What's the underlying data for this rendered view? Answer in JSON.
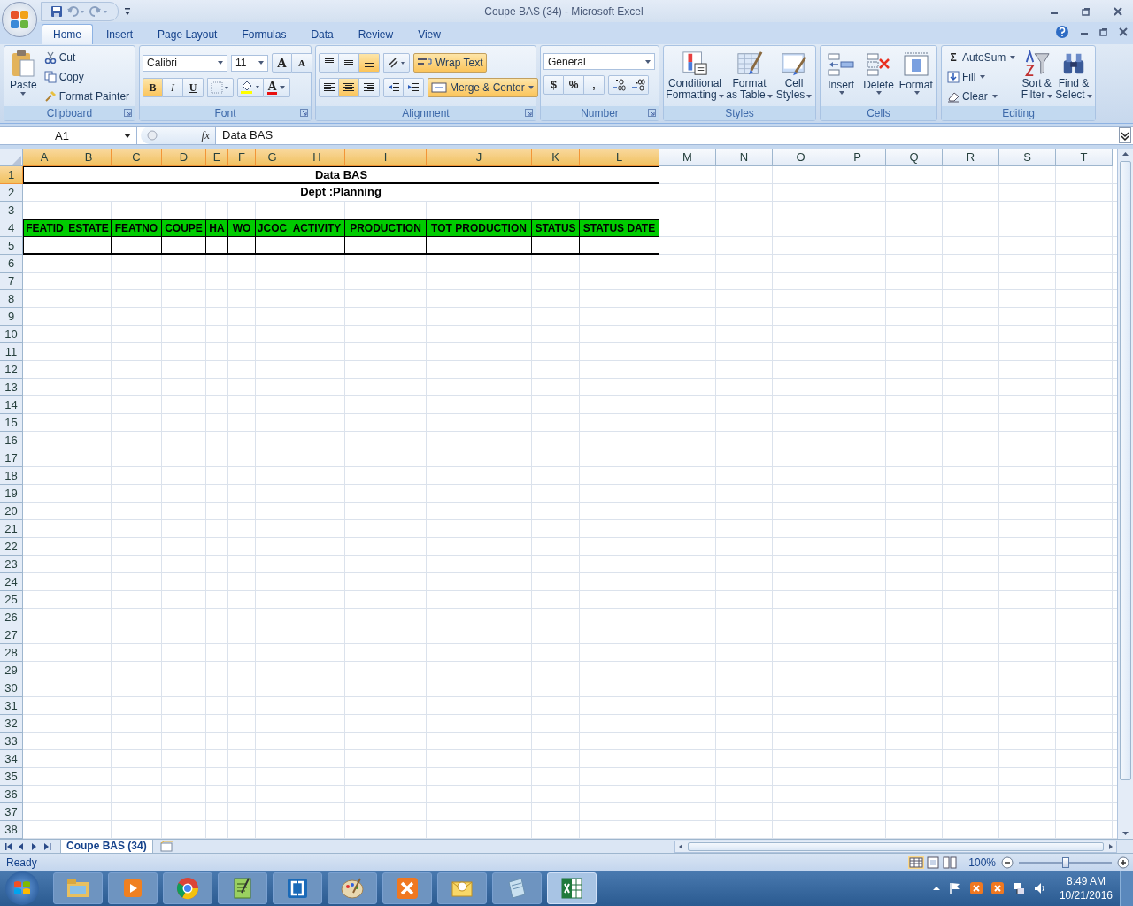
{
  "window": {
    "title": "Coupe BAS (34) - Microsoft Excel"
  },
  "tabs": [
    {
      "label": "Home",
      "selected": true
    },
    {
      "label": "Insert",
      "selected": false
    },
    {
      "label": "Page Layout",
      "selected": false
    },
    {
      "label": "Formulas",
      "selected": false
    },
    {
      "label": "Data",
      "selected": false
    },
    {
      "label": "Review",
      "selected": false
    },
    {
      "label": "View",
      "selected": false
    }
  ],
  "clipboard": {
    "label": "Clipboard",
    "paste": "Paste",
    "cut": "Cut",
    "copy": "Copy",
    "format_painter": "Format Painter"
  },
  "font": {
    "label": "Font",
    "family": "Calibri",
    "size": "11",
    "grow": "A",
    "shrink": "A",
    "styles": [
      {
        "label": "B",
        "on": true
      },
      {
        "label": "I",
        "on": false
      },
      {
        "label": "U",
        "on": false
      }
    ],
    "font_color": "A"
  },
  "alignment": {
    "label": "Alignment",
    "vertical": [
      {
        "on": false
      },
      {
        "on": false
      },
      {
        "on": true
      }
    ],
    "horizontal": [
      {
        "on": false
      },
      {
        "on": true
      },
      {
        "on": false
      }
    ],
    "wrap_text": {
      "label": "Wrap Text",
      "on": true
    },
    "merge_center": {
      "label": "Merge & Center",
      "on": true
    }
  },
  "number": {
    "label": "Number",
    "format": "General",
    "symbols": [
      "$",
      "%",
      ","
    ]
  },
  "styles": {
    "label": "Styles",
    "buttons": [
      [
        "Conditional",
        "Formatting"
      ],
      [
        "Format",
        "as Table"
      ],
      [
        "Cell",
        "Styles"
      ]
    ]
  },
  "cells": {
    "label": "Cells",
    "buttons": [
      "Insert",
      "Delete",
      "Format"
    ]
  },
  "editing": {
    "label": "Editing",
    "autosum_symbol": "Σ",
    "autosum": "AutoSum",
    "fill": "Fill",
    "clear": "Clear",
    "sort_filter": [
      "Sort &",
      "Filter"
    ],
    "find_select": [
      "Find &",
      "Select"
    ]
  },
  "formula_bar": {
    "name_box": "A1",
    "function_symbol": "fx",
    "formula": "Data BAS"
  },
  "sheet": {
    "columns": [
      {
        "label": "A",
        "selected": true
      },
      {
        "label": "B",
        "selected": true
      },
      {
        "label": "C",
        "selected": true
      },
      {
        "label": "D",
        "selected": true
      },
      {
        "label": "E",
        "selected": true
      },
      {
        "label": "F",
        "selected": true
      },
      {
        "label": "G",
        "selected": true
      },
      {
        "label": "H",
        "selected": true
      },
      {
        "label": "I",
        "selected": true
      },
      {
        "label": "J",
        "selected": true
      },
      {
        "label": "K",
        "selected": true
      },
      {
        "label": "L",
        "selected": true
      },
      {
        "label": "M",
        "selected": false
      },
      {
        "label": "N",
        "selected": false
      },
      {
        "label": "O",
        "selected": false
      },
      {
        "label": "P",
        "selected": false
      },
      {
        "label": "Q",
        "selected": false
      },
      {
        "label": "R",
        "selected": false
      },
      {
        "label": "S",
        "selected": false
      },
      {
        "label": "T",
        "selected": false
      }
    ],
    "rows": [
      {
        "label": "1",
        "selected": true
      },
      {
        "label": "2",
        "selected": false
      },
      {
        "label": "3",
        "selected": false
      },
      {
        "label": "4",
        "selected": false
      },
      {
        "label": "5",
        "selected": false
      },
      {
        "label": "6",
        "selected": false
      },
      {
        "label": "7",
        "selected": false
      },
      {
        "label": "8",
        "selected": false
      },
      {
        "label": "9",
        "selected": false
      },
      {
        "label": "10",
        "selected": false
      },
      {
        "label": "11",
        "selected": false
      },
      {
        "label": "12",
        "selected": false
      },
      {
        "label": "13",
        "selected": false
      },
      {
        "label": "14",
        "selected": false
      },
      {
        "label": "15",
        "selected": false
      },
      {
        "label": "16",
        "selected": false
      },
      {
        "label": "17",
        "selected": false
      },
      {
        "label": "18",
        "selected": false
      },
      {
        "label": "19",
        "selected": false
      },
      {
        "label": "20",
        "selected": false
      },
      {
        "label": "21",
        "selected": false
      },
      {
        "label": "22",
        "selected": false
      },
      {
        "label": "23",
        "selected": false
      },
      {
        "label": "24",
        "selected": false
      },
      {
        "label": "25",
        "selected": false
      },
      {
        "label": "26",
        "selected": false
      },
      {
        "label": "27",
        "selected": false
      },
      {
        "label": "28",
        "selected": false
      },
      {
        "label": "29",
        "selected": false
      },
      {
        "label": "30",
        "selected": false
      },
      {
        "label": "31",
        "selected": false
      },
      {
        "label": "32",
        "selected": false
      },
      {
        "label": "33",
        "selected": false
      },
      {
        "label": "34",
        "selected": false
      },
      {
        "label": "35",
        "selected": false
      },
      {
        "label": "36",
        "selected": false
      },
      {
        "label": "37",
        "selected": false
      },
      {
        "label": "38",
        "selected": false
      }
    ],
    "title": "Data BAS",
    "subtitle": "Dept :Planning",
    "headers": [
      "FEATID",
      "ESTATE",
      "FEATNO",
      "COUPE",
      "HA",
      "WO",
      "JCOC",
      "ACTIVITY",
      "PRODUCTION",
      "TOT PRODUCTION",
      "STATUS",
      "STATUS DATE"
    ]
  },
  "sheet_tabs": [
    {
      "label": "Coupe BAS (34)",
      "selected": true
    }
  ],
  "status_bar": {
    "text": "Ready",
    "zoom": "100%",
    "zoom_slider": {
      "level": 0.5
    }
  },
  "taskbar": {
    "apps": [
      {
        "selected": false
      },
      {
        "selected": false
      },
      {
        "selected": false
      },
      {
        "selected": false
      },
      {
        "selected": false
      },
      {
        "selected": false
      },
      {
        "selected": false
      },
      {
        "selected": false
      },
      {
        "selected": false
      },
      {
        "selected": true
      }
    ],
    "time": "8:49 AM",
    "date": "10/21/2016"
  }
}
